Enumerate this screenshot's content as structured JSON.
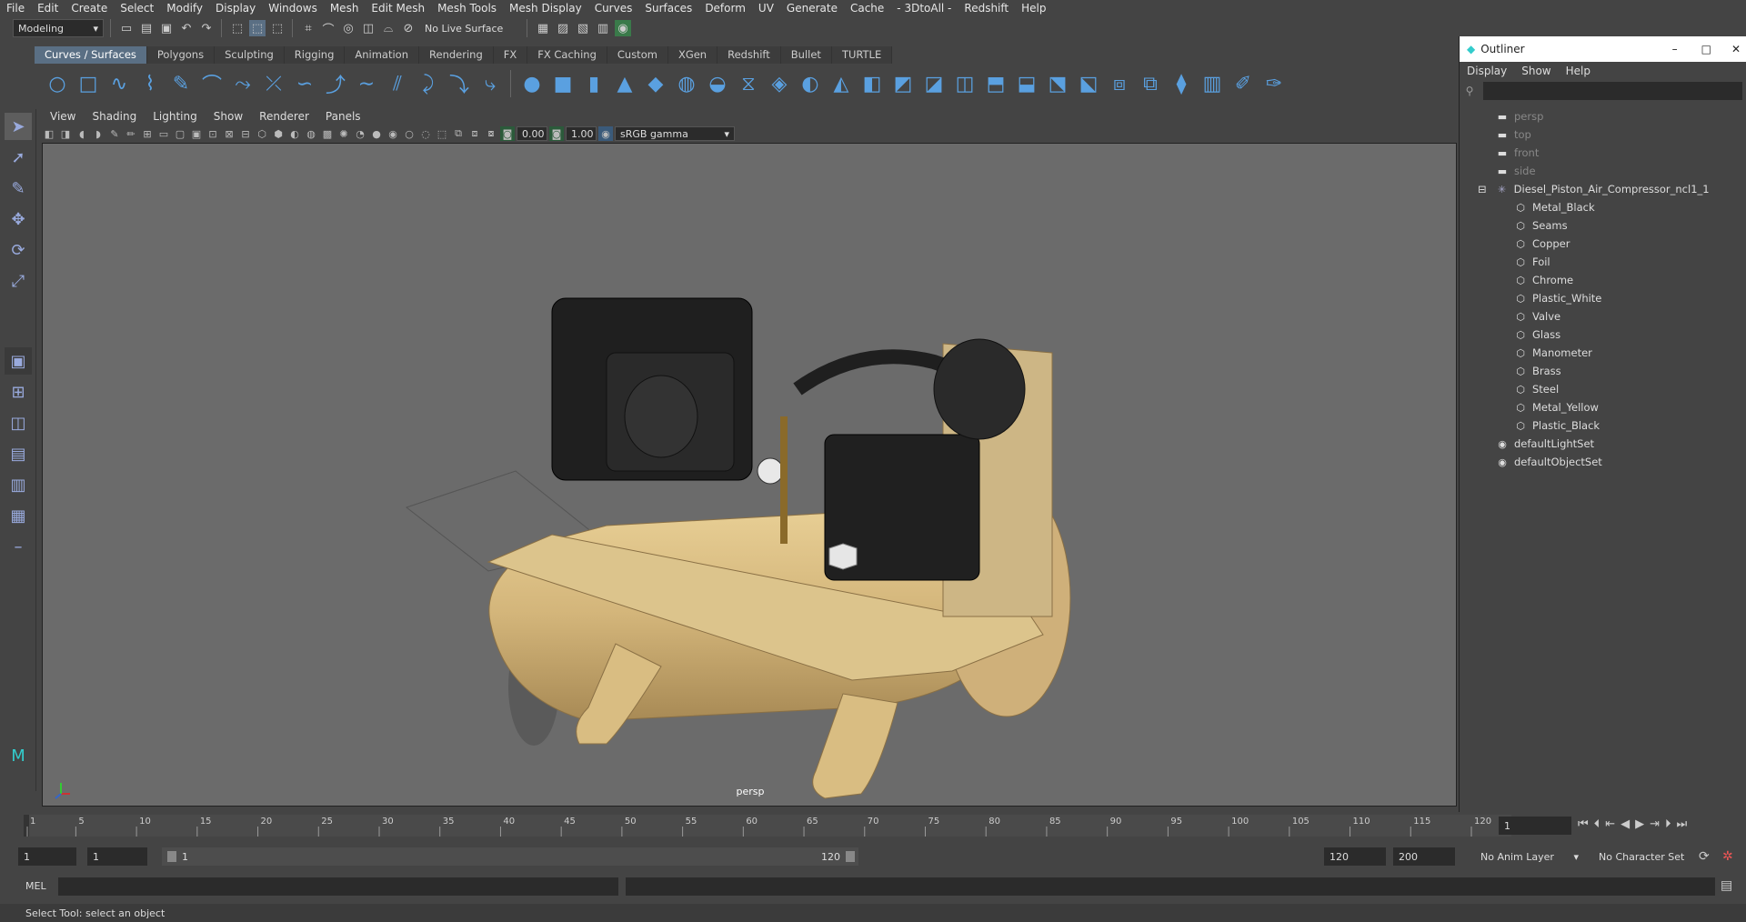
{
  "menubar": [
    "File",
    "Edit",
    "Create",
    "Select",
    "Modify",
    "Display",
    "Windows",
    "Mesh",
    "Edit Mesh",
    "Mesh Tools",
    "Mesh Display",
    "Curves",
    "Surfaces",
    "Deform",
    "UV",
    "Generate",
    "Cache",
    "- 3DtoAll -",
    "Redshift",
    "Help"
  ],
  "statusline": {
    "workspace": "Modeling",
    "live_surface": "No Live Surface"
  },
  "shelf_tabs": [
    "Curves / Surfaces",
    "Polygons",
    "Sculpting",
    "Rigging",
    "Animation",
    "Rendering",
    "FX",
    "FX Caching",
    "Custom",
    "XGen",
    "Redshift",
    "Bullet",
    "TURTLE"
  ],
  "viewport": {
    "menu": [
      "View",
      "Shading",
      "Lighting",
      "Show",
      "Renderer",
      "Panels"
    ],
    "exposure": "0.00",
    "gamma": "1.00",
    "color_space": "sRGB gamma",
    "camera_label": "persp"
  },
  "outliner": {
    "title": "Outliner",
    "menu": [
      "Display",
      "Show",
      "Help"
    ],
    "cameras": [
      "persp",
      "top",
      "front",
      "side"
    ],
    "root": "Diesel_Piston_Air_Compressor_ncl1_1",
    "children": [
      "Metal_Black",
      "Seams",
      "Copper",
      "Foil",
      "Chrome",
      "Plastic_White",
      "Valve",
      "Glass",
      "Manometer",
      "Brass",
      "Steel",
      "Metal_Yellow",
      "Plastic_Black"
    ],
    "sets": [
      "defaultLightSet",
      "defaultObjectSet"
    ]
  },
  "timeline": {
    "ticks": [
      "1",
      "5",
      "10",
      "15",
      "20",
      "25",
      "30",
      "35",
      "40",
      "45",
      "50",
      "55",
      "60",
      "65",
      "70",
      "75",
      "80",
      "85",
      "90",
      "95",
      "100",
      "105",
      "110",
      "115",
      "120"
    ],
    "current_frame": "1"
  },
  "range": {
    "start": "1",
    "start2": "1",
    "slider_start": "1",
    "slider_end": "120",
    "end": "120",
    "end2": "200",
    "anim_layer": "No Anim Layer",
    "char_set": "No Character Set"
  },
  "cmd": {
    "label": "MEL"
  },
  "help_line": "Select Tool: select an object",
  "colors": {
    "accent": "#5a6f84",
    "tank": "#d9bd82",
    "viewport_bg": "#6b6b6b"
  }
}
